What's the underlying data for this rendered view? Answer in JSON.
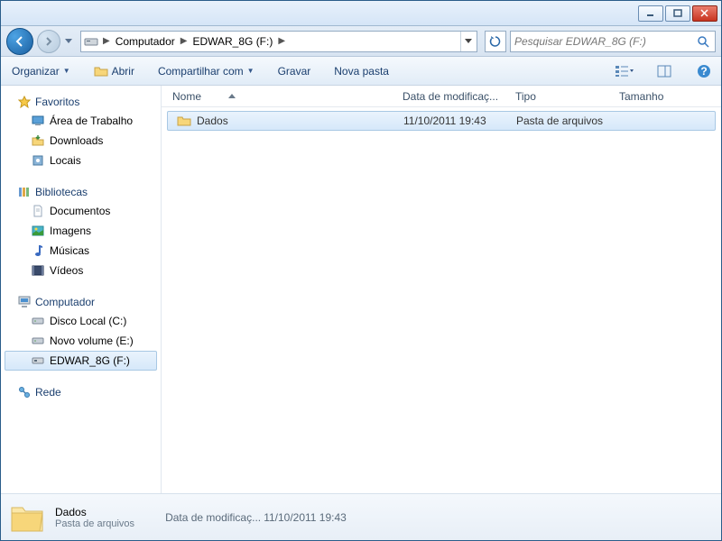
{
  "breadcrumb": {
    "part1": "Computador",
    "part2": "EDWAR_8G (F:)"
  },
  "search": {
    "placeholder": "Pesquisar EDWAR_8G (F:)"
  },
  "toolbar": {
    "organize": "Organizar",
    "open": "Abrir",
    "share": "Compartilhar com",
    "burn": "Gravar",
    "newfolder": "Nova pasta"
  },
  "sidebar": {
    "favorites": {
      "label": "Favoritos",
      "items": [
        "Área de Trabalho",
        "Downloads",
        "Locais"
      ]
    },
    "libraries": {
      "label": "Bibliotecas",
      "items": [
        "Documentos",
        "Imagens",
        "Músicas",
        "Vídeos"
      ]
    },
    "computer": {
      "label": "Computador",
      "items": [
        "Disco Local (C:)",
        "Novo volume (E:)",
        "EDWAR_8G (F:)"
      ]
    },
    "network": {
      "label": "Rede"
    }
  },
  "columns": {
    "name": "Nome",
    "date": "Data de modificaç...",
    "type": "Tipo",
    "size": "Tamanho"
  },
  "files": [
    {
      "name": "Dados",
      "date": "11/10/2011 19:43",
      "type": "Pasta de arquivos",
      "size": ""
    }
  ],
  "details": {
    "title": "Dados",
    "subtitle": "Pasta de arquivos",
    "datelabel": "Data de modificaç...",
    "datevalue": "11/10/2011 19:43"
  }
}
